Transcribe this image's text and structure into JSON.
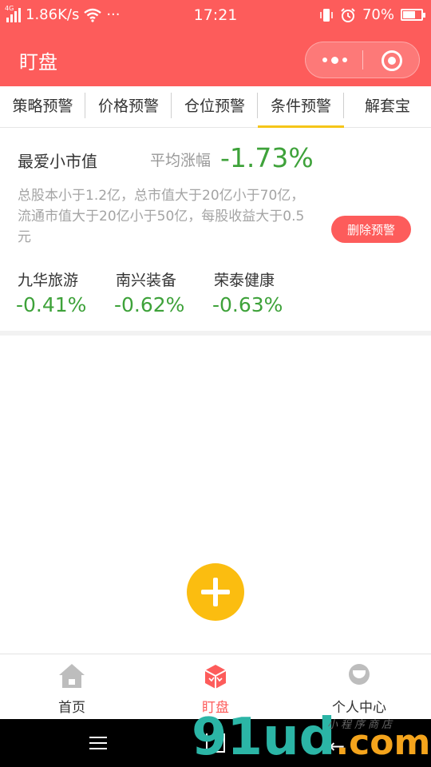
{
  "status_bar": {
    "network_type": "4G",
    "speed": "1.86K/s",
    "dots": "···",
    "time": "17:21",
    "battery_text": "70%",
    "battery_level": 0.7
  },
  "header": {
    "title": "盯盘",
    "accent_color": "#fd5c5b"
  },
  "tabs": [
    {
      "label": "策略预警",
      "active": false
    },
    {
      "label": "价格预警",
      "active": false
    },
    {
      "label": "仓位预警",
      "active": false
    },
    {
      "label": "条件预警",
      "active": true
    },
    {
      "label": "解套宝",
      "active": false
    }
  ],
  "alert_card": {
    "name": "最爱小市值",
    "avg_label": "平均涨幅",
    "avg_value": "-1.73%",
    "condition": "总股本小于1.2亿，总市值大于20亿小于70亿，流通市值大于20亿小于50亿，每股收益大于0.5元",
    "delete_label": "删除预警",
    "stocks": [
      {
        "name": "九华旅游",
        "change": "-0.41%"
      },
      {
        "name": "南兴装备",
        "change": "-0.62%"
      },
      {
        "name": "荣泰健康",
        "change": "-0.63%"
      }
    ]
  },
  "fab": {
    "icon": "plus-icon",
    "color": "#fbbd10"
  },
  "tabbar": {
    "items": [
      {
        "label": "首页",
        "icon": "home-icon",
        "active": false
      },
      {
        "label": "盯盘",
        "icon": "cube-icon",
        "active": true
      },
      {
        "label": "个人中心",
        "icon": "profile-icon",
        "active": false
      }
    ]
  },
  "watermark": {
    "logo": "91ud",
    "tld": ".com",
    "sub": "小程序商店"
  }
}
